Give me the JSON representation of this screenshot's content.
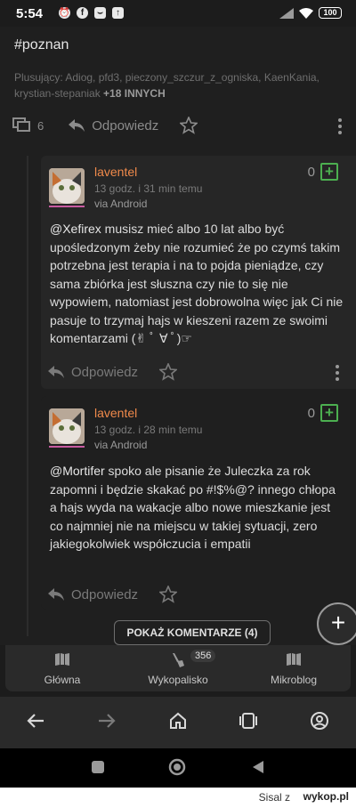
{
  "status_bar": {
    "time": "5:54",
    "battery": "100"
  },
  "post": {
    "hashtag": "#poznan",
    "plusers_prefix": "Plusujący: Adiog, pfd3, pieczony_szczur_z_ogniska, KaenKania, krystian-stepaniak ",
    "plusers_more": "+18 INNYCH",
    "comment_count": "6",
    "reply_label": "Odpowiedz"
  },
  "comments": [
    {
      "author": "laventel",
      "time": "13 godz. i 31 min temu",
      "via": "via Android",
      "score": "0",
      "mention": "@Xefirex",
      "text": " musisz mieć albo 10 lat albo być upośledzonym żeby nie rozumieć że po czymś takim potrzebna jest terapia i na to pojda pieniądze, czy sama zbiórka jest słuszna czy nie to się nie wypowiem, natomiast jest dobrowolna więc jak Ci nie pasuje to trzymaj hajs w kieszeni razem ze swoimi komentarzami (✌ ﾟ ∀ ﾟ)☞",
      "reply_label": "Odpowiedz"
    },
    {
      "author": "laventel",
      "time": "13 godz. i 28 min temu",
      "via": "via Android",
      "score": "0",
      "mention": "@Mortifer",
      "text": " spoko ale pisanie że Juleczka za rok zapomni i będzie skakać po #!$%@? innego chłopa a hajs wyda na wakacje albo nowe mieszkanie jest co najmniej nie na miejscu w takiej sytuacji, zero jakiegokolwiek współczucia i empatii",
      "reply_label": "Odpowiedz"
    }
  ],
  "show_comments_label": "POKAŻ KOMENTARZE (4)",
  "app_nav": {
    "items": [
      {
        "label": "Główna",
        "icon": "home-icon"
      },
      {
        "label": "Wykopalisko",
        "icon": "shovel-icon",
        "badge": "356"
      },
      {
        "label": "Mikroblog",
        "icon": "mikroblog-icon"
      }
    ]
  },
  "footer": {
    "text": "Sisal z",
    "logo": "wykop.pl"
  },
  "colors": {
    "author": "#f08a4b",
    "vote": "#4caf50",
    "avatar_bar": "#c85aa0"
  }
}
